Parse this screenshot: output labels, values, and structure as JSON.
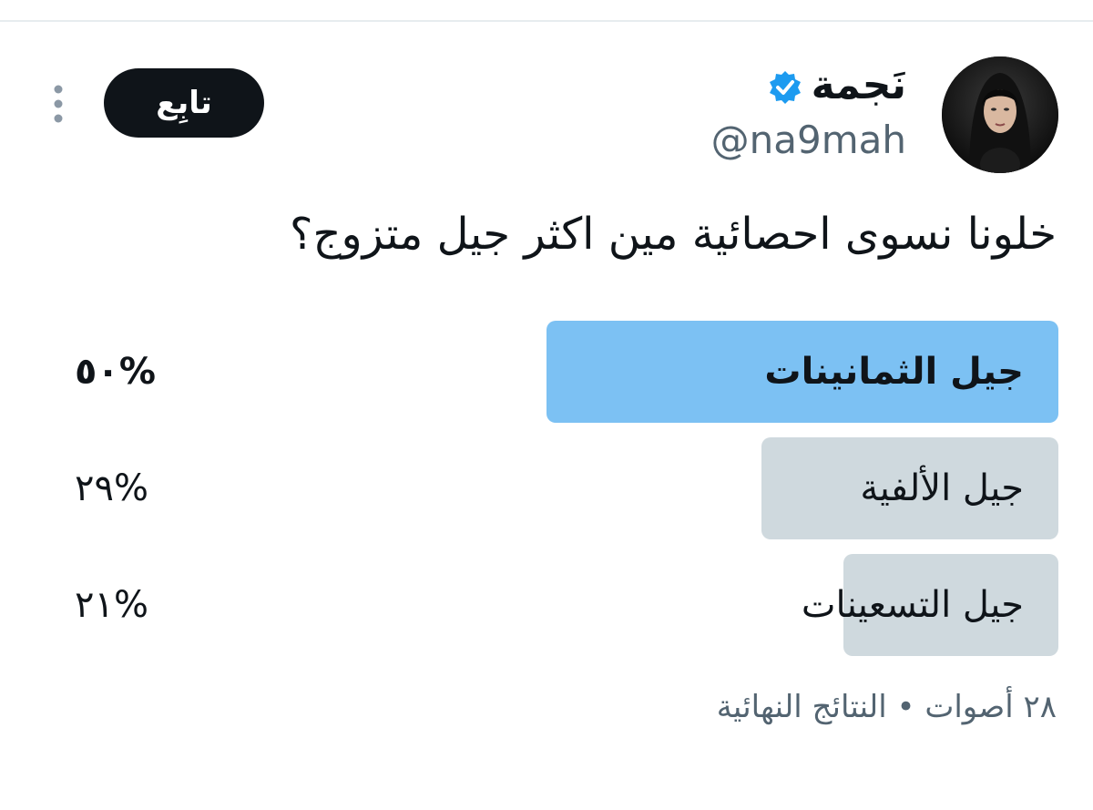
{
  "user": {
    "display_name": "نَجمة",
    "handle": "@na9mah",
    "verified": true
  },
  "actions": {
    "follow_label": "تابِع"
  },
  "icons": {
    "verified": "verified-badge-icon",
    "more": "more-vertical-icon"
  },
  "tweet": {
    "text": "خلونا نسوى احصائية مين اكثر جيل متزوج؟"
  },
  "poll": {
    "options": [
      {
        "label": "جيل الثمانينات",
        "percent_text": "%٥٠",
        "percent": 50,
        "winner": true
      },
      {
        "label": "جيل الألفية",
        "percent_text": "%٢٩",
        "percent": 29,
        "winner": false
      },
      {
        "label": "جيل التسعينات",
        "percent_text": "%٢١",
        "percent": 21,
        "winner": false
      }
    ],
    "meta": "٢٨ أصوات • النتائج النهائية"
  },
  "colors": {
    "winner_bar": "#7cc1f3",
    "other_bar": "#cfd9de",
    "follow_bg": "#0f1419",
    "verified_blue": "#1d9bf0",
    "secondary_text": "#536471"
  }
}
